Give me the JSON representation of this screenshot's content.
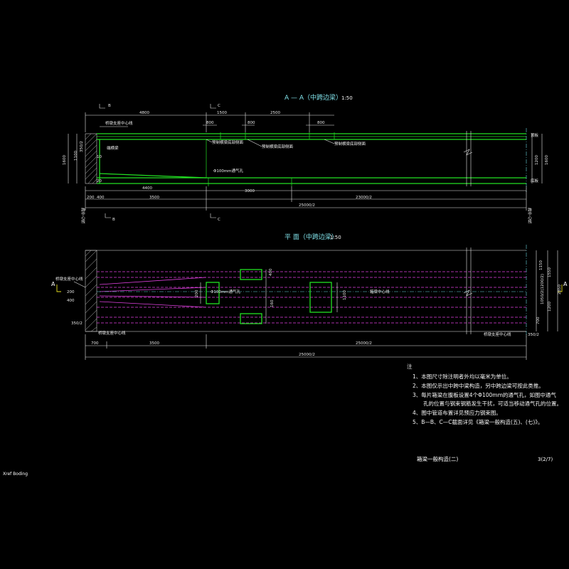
{
  "elevation": {
    "title": "A — A（中跨边梁）",
    "scale": "1:50",
    "top_dims": [
      "4800",
      "1500",
      "2500",
      "800",
      "800",
      "800"
    ],
    "left_dims": [
      "350/2",
      "1100",
      "1600"
    ],
    "right_dims": [
      "1200",
      "1600"
    ],
    "bottom_dims": [
      "200",
      "400",
      "4400",
      "3500",
      "3000",
      "25000/2",
      "23000/2"
    ],
    "labels": {
      "bearing_center": "桥墩支座中心线",
      "end_beam": "端横梁",
      "diaphragm1": "预制横梁底部侧面",
      "diaphragm2": "预制横梁底部侧面",
      "diaphragm3": "预制横梁底部侧面",
      "vent": "Φ100mm通气孔",
      "top_right_1": "顶板",
      "top_right_2": "底板",
      "left_small": "10",
      "left_small2": "20"
    },
    "sections": {
      "b_top": "B",
      "c_top": "C",
      "b_bottom": "B",
      "c_bottom": "C"
    }
  },
  "side_labels": {
    "left_vertical": "跨中心线",
    "right_vertical": "跨中心线"
  },
  "plan": {
    "title": "平 面（中跨边梁）",
    "scale": "1:50",
    "labels": {
      "bearing_center": "桥墩支座中心线",
      "vent": "Φ100mm通气孔",
      "beam_center": "箱梁中心线",
      "bearing_right": "桥墩支座中心线",
      "left_a": "A",
      "right_a": "A",
      "dim_bl": "350/2"
    },
    "inner_dims": [
      "200",
      "400",
      "160",
      "1100"
    ],
    "right_dims": [
      "1150",
      "1550",
      "2850",
      "1200",
      "700",
      "1050/2(1200/2)",
      "350/2"
    ],
    "bottom_dims": [
      "700",
      "3500",
      "25000/2",
      "25000/2"
    ]
  },
  "notes": {
    "heading": "注",
    "items": [
      "1、本图尺寸除注明者外均以毫米为单位。",
      "2、本图仅示出中跨中梁构造，另中跨边梁可按此类推。",
      "3、每片箱梁在腹板设置4个Φ100mm的通气孔，如图中通气",
      "　　孔的位置与钢束钢筋发生干扰，可适当移动通气孔的位置。",
      "4、图中管道布置详见预应力钢束图。",
      "5、B—B、C—C截面详见《箱梁一般构造(五)、(七)》。"
    ]
  },
  "title_block": {
    "drawing_name": "箱梁一般构造(二)",
    "sheet": "3(2/7)"
  },
  "footer": "Xref Boding"
}
